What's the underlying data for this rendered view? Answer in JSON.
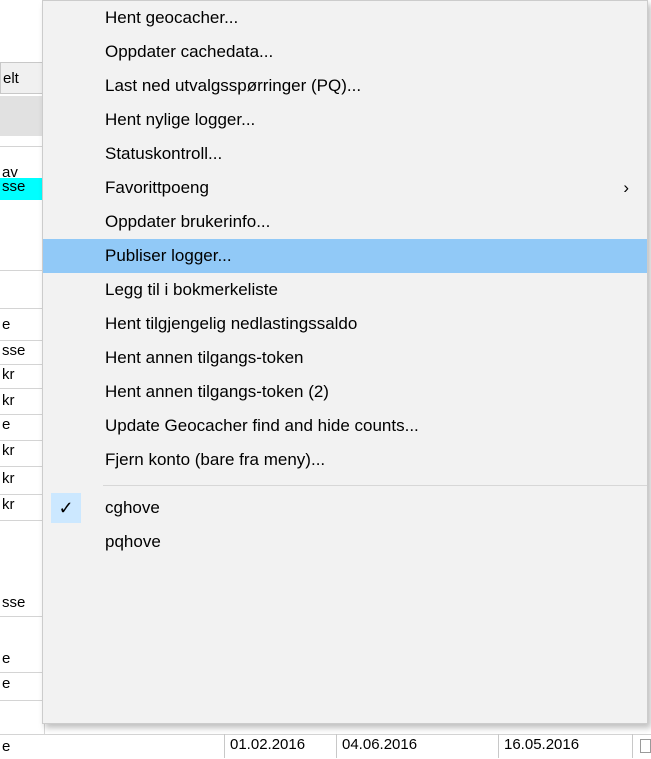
{
  "background": {
    "cells": [
      {
        "text": "elt"
      },
      {
        "text": "av"
      },
      {
        "text": "sse"
      },
      {
        "text": "e"
      },
      {
        "text": "sse"
      },
      {
        "text": "kr"
      },
      {
        "text": "kr"
      },
      {
        "text": "e"
      },
      {
        "text": "kr"
      },
      {
        "text": "kr"
      },
      {
        "text": "kr"
      },
      {
        "text": "sse"
      },
      {
        "text": "e"
      },
      {
        "text": "e"
      },
      {
        "text": "e"
      }
    ],
    "dates": [
      "01.02.2016",
      "04.06.2016",
      "16.05.2016"
    ]
  },
  "menu": {
    "items": [
      {
        "label": "Hent geocacher..."
      },
      {
        "label": "Oppdater cachedata..."
      },
      {
        "label": "Last ned utvalgsspørringer (PQ)..."
      },
      {
        "label": "Hent nylige logger..."
      },
      {
        "label": "Statuskontroll..."
      },
      {
        "label": "Favorittpoeng",
        "submenu_icon": "chevron-right-icon"
      },
      {
        "label": "Oppdater brukerinfo..."
      },
      {
        "label": "Publiser logger...",
        "highlighted": true
      },
      {
        "label": "Legg til i bokmerkeliste"
      },
      {
        "label": "Hent tilgjengelig nedlastingssaldo"
      },
      {
        "label": "Hent annen tilgangs-token"
      },
      {
        "label": "Hent annen tilgangs-token (2)"
      },
      {
        "label": "Update Geocacher find and hide counts..."
      },
      {
        "label": "Fjern konto (bare fra meny)..."
      }
    ],
    "accounts": [
      {
        "label": "cghove",
        "checked": true,
        "check_icon": "checkmark-icon"
      },
      {
        "label": "pqhove"
      }
    ],
    "arrow_glyph": "›",
    "check_glyph": "✓",
    "highlight_color": "#91c9f7",
    "check_bg_color": "#cce8ff"
  }
}
